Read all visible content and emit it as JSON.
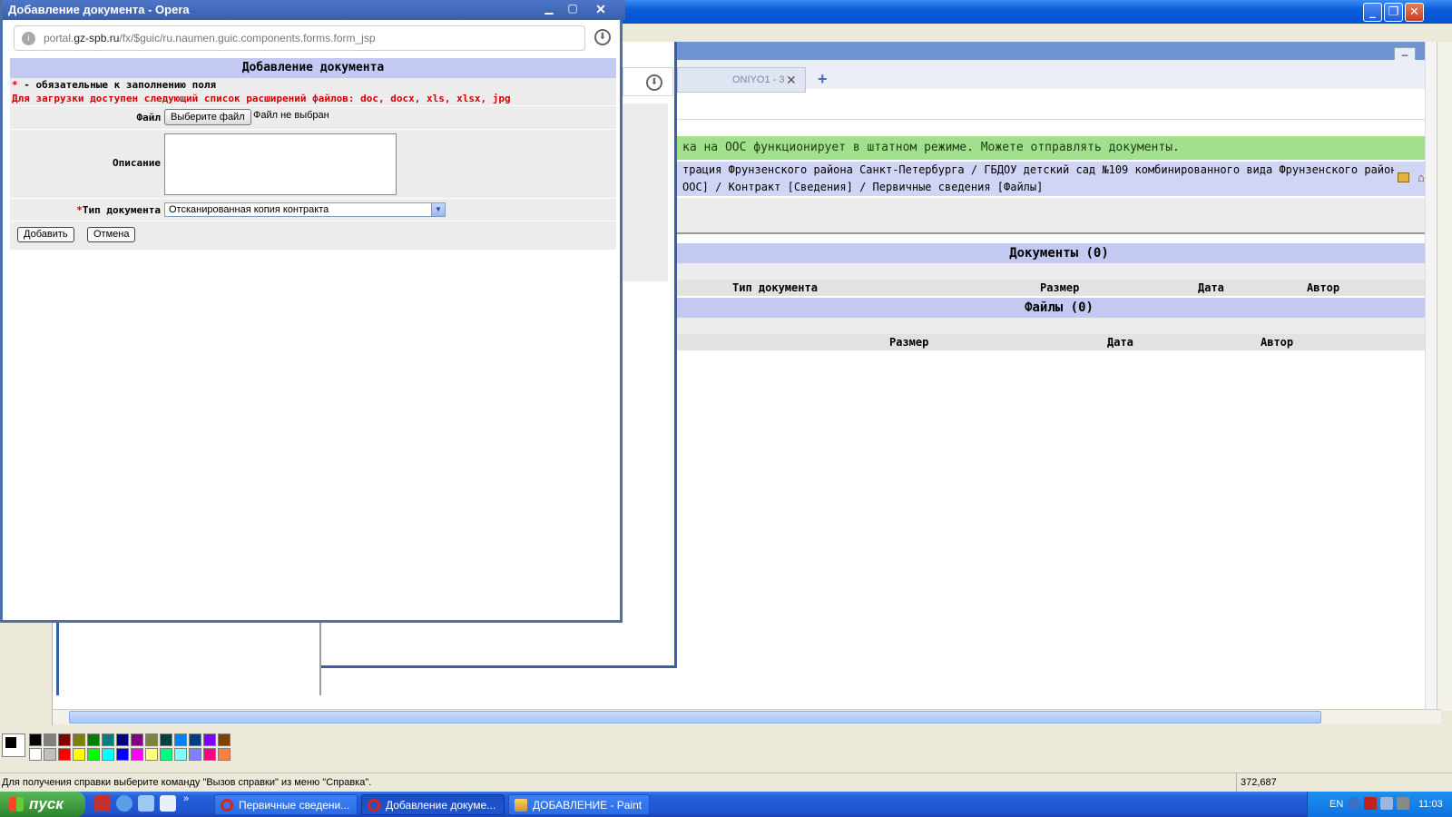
{
  "dialog": {
    "title": "Добавление документа - Opera",
    "url_prefix": "portal.",
    "url_domain": "gz-spb.ru",
    "url_path": "/fx/$guic/ru.naumen.guic.components.forms.form_jsp",
    "form_heading": "Добавление документа",
    "required_star": "*",
    "required_note": " - обязательные к заполнению поля",
    "extensions_note": "Для загрузки доступен следующий список расширений файлов: doc, docx, xls, xlsx, jpg",
    "file_label": "Файл",
    "file_button": "Выберите файл",
    "file_status": "Файл не выбран",
    "description_label": "Описание",
    "description_value": "",
    "type_label": "Тип документа",
    "type_selected": "Отсканированная копия контракта",
    "add_button": "Добавить",
    "cancel_button": "Отмена"
  },
  "background_page": {
    "tab_label": "ONIYO1 - 3",
    "status_message": "ка на ООС функционирует в штатном режиме. Можете отправлять документы.",
    "breadcrumb_line1": "трация Фрунзенского района Санкт-Петербурга / ГБДОУ детский сад №109 комбинированного вида Фрунзенского района Санкт-",
    "breadcrumb_line2": "ООС] / Контракт [Сведения] / Первичные сведения [Файлы]",
    "documents_title": "Документы (0)",
    "documents_columns": [
      "Тип документа",
      "Размер",
      "Дата",
      "Автор"
    ],
    "files_title": "Файлы (0)",
    "files_columns": [
      "Размер",
      "Дата",
      "Автор"
    ]
  },
  "paint": {
    "status_help": "Для получения справки выберите команду \"Вызов справки\" из меню \"Справка\".",
    "coords": "372,687",
    "palette_top": [
      "#000000",
      "#808080",
      "#800000",
      "#808000",
      "#008000",
      "#008080",
      "#000080",
      "#800080",
      "#808040",
      "#004040",
      "#0080ff",
      "#004080",
      "#8000ff",
      "#804000"
    ],
    "palette_bottom": [
      "#ffffff",
      "#c0c0c0",
      "#ff0000",
      "#ffff00",
      "#00ff00",
      "#00ffff",
      "#0000ff",
      "#ff00ff",
      "#ffff80",
      "#00ff80",
      "#80ffff",
      "#8080ff",
      "#ff0080",
      "#ff8040"
    ]
  },
  "taskbar": {
    "start_label": "пуск",
    "tasks": [
      "Первичные сведени...",
      "Добавление докуме...",
      "ДОБАВЛЕНИЕ - Paint"
    ],
    "language": "EN",
    "clock": "11:03"
  }
}
